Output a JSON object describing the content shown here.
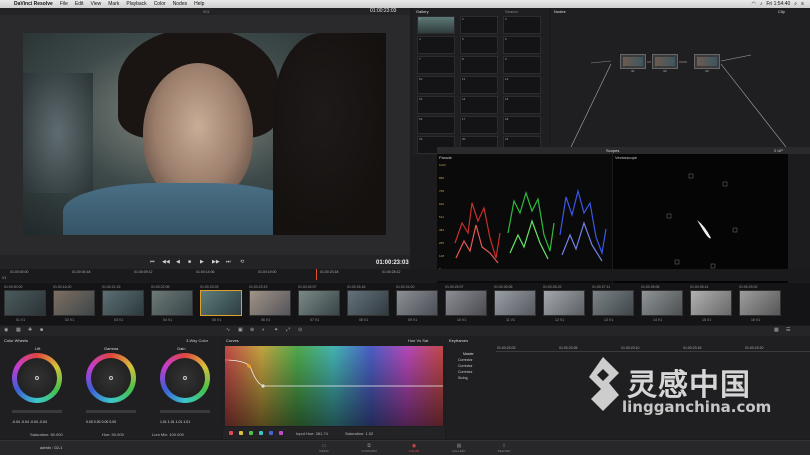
{
  "menubar": {
    "app_name": "DaVinci Resolve",
    "items": [
      "File",
      "Edit",
      "View",
      "Mark",
      "Playback",
      "Color",
      "Nodes",
      "Help"
    ],
    "clock": "Fri 1:54:40"
  },
  "viewer": {
    "source_label": "001",
    "timecode_top": "01:00:23:03",
    "timecode_transport": "01:00:23:03"
  },
  "gallery": {
    "title": "Gallery",
    "search": "Search",
    "stills": [
      "1",
      "2",
      "3",
      "4",
      "5",
      "6",
      "7",
      "8",
      "9",
      "10",
      "11",
      "12",
      "13",
      "14",
      "15",
      "16",
      "17",
      "18",
      "19",
      "20",
      "21"
    ]
  },
  "nodes": {
    "title": "Nodes",
    "clip_label": "Clip",
    "items": [
      "01",
      "02",
      "03"
    ]
  },
  "scopes": {
    "title": "Scopes",
    "mode": "2 UP",
    "parade_label": "Parade",
    "vectorscope_label": "Vectorscope",
    "scale": [
      "1023",
      "896",
      "768",
      "640",
      "512",
      "384",
      "256",
      "128",
      "0"
    ]
  },
  "timeline": {
    "ruler": [
      "01:00:00:00",
      "01:00:04:18",
      "01:00:09:12",
      "01:00:14:06",
      "01:00:19:00",
      "01:00:23:18",
      "01:00:28:12"
    ],
    "ruler_left": "V1",
    "clips": [
      {
        "tc": "01:00:00:00",
        "label": "01 V1",
        "c1": "#4b5a5e",
        "c2": "#2b3336"
      },
      {
        "tc": "01:00:16:20",
        "label": "02 V1",
        "c1": "#7e6f63",
        "c2": "#3d4648"
      },
      {
        "tc": "01:00:21:15",
        "label": "03 V1",
        "c1": "#5c6f73",
        "c2": "#2d3a3d"
      },
      {
        "tc": "01:00:22:05",
        "label": "04 V1",
        "c1": "#6d7a78",
        "c2": "#384447"
      },
      {
        "tc": "01:00:23:03",
        "label": "05 V1",
        "c1": "#5e7d7b",
        "c2": "#2e3d3f"
      },
      {
        "tc": "01:00:23:19",
        "label": "06 V1",
        "c1": "#a19387",
        "c2": "#54545a"
      },
      {
        "tc": "01:00:24:07",
        "label": "07 V1",
        "c1": "#7a8a88",
        "c2": "#394446"
      },
      {
        "tc": "01:00:24:16",
        "label": "08 V1",
        "c1": "#66727a",
        "c2": "#2f3a40"
      },
      {
        "tc": "01:00:24:20",
        "label": "09 V1",
        "c1": "#8d9095",
        "c2": "#4a4e55"
      },
      {
        "tc": "01:00:25:07",
        "label": "10 V1",
        "c1": "#8c8e94",
        "c2": "#4a4b50"
      },
      {
        "tc": "01:00:26:08",
        "label": "11 V1",
        "c1": "#9a9fa5",
        "c2": "#55595f"
      },
      {
        "tc": "01:00:26:22",
        "label": "12 V1",
        "c1": "#a3a7ab",
        "c2": "#5b5f63"
      },
      {
        "tc": "01:00:27:11",
        "label": "13 V1",
        "c1": "#7c8487",
        "c2": "#3f4549"
      },
      {
        "tc": "01:00:28:06",
        "label": "14 V1",
        "c1": "#8f9497",
        "c2": "#4c5053"
      },
      {
        "tc": "01:00:28:14",
        "label": "15 V1",
        "c1": "#b1b1b1",
        "c2": "#686868"
      },
      {
        "tc": "01:00:29:02",
        "label": "16 V1",
        "c1": "#9e9e9e",
        "c2": "#565656"
      }
    ]
  },
  "wheels": {
    "title": "Color Wheels",
    "mode": "3-Way Color",
    "lift": {
      "label": "Lift",
      "values": "-0.04  -0.04  -0.04  -0.04"
    },
    "gamma": {
      "label": "Gamma",
      "values": "0.00  0.00  0.00  0.00"
    },
    "gain": {
      "label": "Gain",
      "values": "1.01  1.01  1.01  1.01"
    },
    "saturation": "Saturation: 50.000",
    "hue": "Hue: 50.000",
    "lum_mix": "Lum Mix: 100.000"
  },
  "curves": {
    "title": "Curves",
    "mode": "Hue Vs Sat",
    "input_hue": "Input Hue: 281.74",
    "saturation": "Saturation: 1.02",
    "swatches": [
      "#e04a4a",
      "#d9c040",
      "#4fc04f",
      "#40c2c2",
      "#4a60d6",
      "#c04ac8"
    ]
  },
  "keyframes": {
    "title": "Keyframes",
    "timecodes": [
      "01:00:23:03",
      "01:00:23:05",
      "01:00:23:10",
      "01:00:23:15",
      "01:00:23:20"
    ],
    "master": "Master",
    "rows": [
      "Corrector",
      "Corrector",
      "Corrector",
      "Sizing"
    ]
  },
  "pagebar": {
    "user": "admin : 02-1",
    "pages": [
      "MEDIA",
      "CONFORM",
      "COLOR",
      "GALLERY",
      "DELIVER"
    ]
  },
  "watermark": {
    "text": "灵感中国",
    "url": "lingganchina.com"
  }
}
